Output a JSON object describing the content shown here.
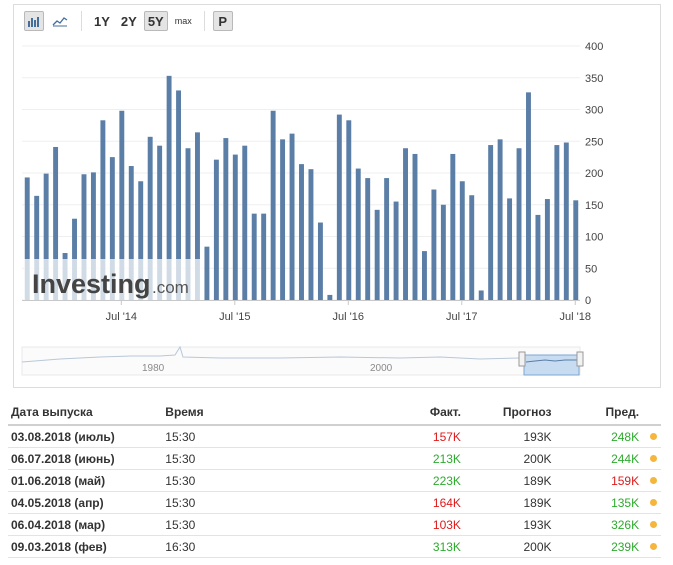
{
  "toolbar": {
    "chart_bar_icon": "bar-chart-icon",
    "chart_area_icon": "area-chart-icon",
    "ranges": [
      "1Y",
      "2Y",
      "5Y",
      "max"
    ],
    "active_range": "5Y",
    "p_label": "P"
  },
  "watermark": {
    "brand": "Investing",
    "suffix": ".com"
  },
  "navigator": {
    "labels": [
      "1980",
      "2000"
    ]
  },
  "colors": {
    "bar": "#5a7ea6",
    "positive": "#2daa2d",
    "negative": "#dd1b1b",
    "dot": "#f4b73b"
  },
  "chart_data": {
    "type": "bar",
    "ylim": [
      0,
      400
    ],
    "yticks": [
      0,
      50,
      100,
      150,
      200,
      250,
      300,
      350,
      400
    ],
    "xtick_labels": [
      "Jul '14",
      "Jul '15",
      "Jul '16",
      "Jul '17",
      "Jul '18"
    ],
    "start": "2013-09",
    "values": [
      193,
      164,
      199,
      241,
      74,
      128,
      198,
      201,
      283,
      225,
      298,
      211,
      187,
      257,
      243,
      353,
      330,
      239,
      264,
      84,
      221,
      255,
      229,
      243,
      136,
      136,
      298,
      253,
      262,
      214,
      206,
      122,
      8,
      292,
      283,
      207,
      192,
      142,
      192,
      155,
      239,
      230,
      77,
      174,
      150,
      230,
      187,
      165,
      15,
      244,
      253,
      160,
      239,
      327,
      134,
      159,
      244,
      248,
      157
    ]
  },
  "table": {
    "headers": {
      "date": "Дата выпуска",
      "time": "Время",
      "actual": "Факт.",
      "forecast": "Прогноз",
      "previous": "Пред."
    },
    "rows": [
      {
        "date": "03.08.2018 (июль)",
        "time": "15:30",
        "actual": "157K",
        "actual_color": "#dd1b1b",
        "forecast": "193K",
        "previous": "248K",
        "previous_color": "#2daa2d"
      },
      {
        "date": "06.07.2018 (июнь)",
        "time": "15:30",
        "actual": "213K",
        "actual_color": "#2daa2d",
        "forecast": "200K",
        "previous": "244K",
        "previous_color": "#2daa2d"
      },
      {
        "date": "01.06.2018 (май)",
        "time": "15:30",
        "actual": "223K",
        "actual_color": "#2daa2d",
        "forecast": "189K",
        "previous": "159K",
        "previous_color": "#dd1b1b"
      },
      {
        "date": "04.05.2018 (апр)",
        "time": "15:30",
        "actual": "164K",
        "actual_color": "#dd1b1b",
        "forecast": "189K",
        "previous": "135K",
        "previous_color": "#2daa2d"
      },
      {
        "date": "06.04.2018 (мар)",
        "time": "15:30",
        "actual": "103K",
        "actual_color": "#dd1b1b",
        "forecast": "193K",
        "previous": "326K",
        "previous_color": "#2daa2d"
      },
      {
        "date": "09.03.2018 (фев)",
        "time": "16:30",
        "actual": "313K",
        "actual_color": "#2daa2d",
        "forecast": "200K",
        "previous": "239K",
        "previous_color": "#2daa2d"
      }
    ]
  }
}
